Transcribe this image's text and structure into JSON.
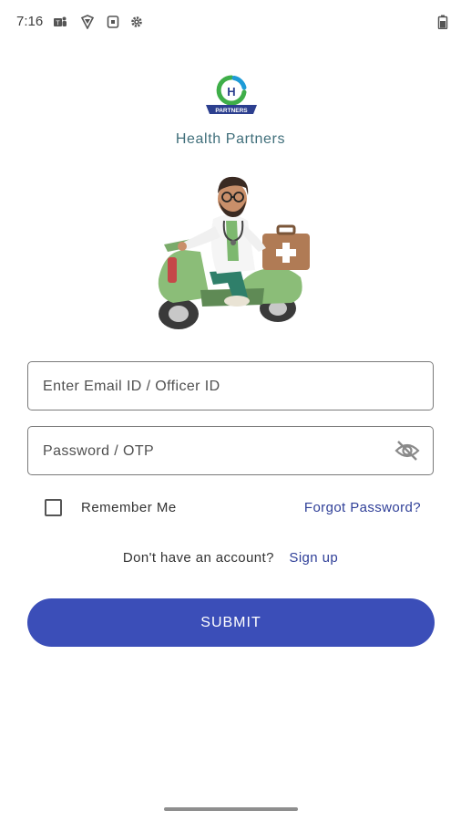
{
  "status_bar": {
    "time": "7:16"
  },
  "brand": {
    "title": "Health Partners",
    "logo_text": "PARTNERS",
    "logo_letter": "H"
  },
  "login_form": {
    "email_placeholder": "Enter Email ID / Officer ID",
    "password_placeholder": "Password / OTP",
    "remember_label": "Remember Me",
    "remember_checked": false,
    "forgot_label": "Forgot Password?",
    "signup_prompt": "Don't have an account?",
    "signup_label": "Sign up",
    "submit_label": "SUBMIT"
  },
  "icons": {
    "status": [
      "teams-icon",
      "vpn-shield-icon",
      "sim-card-icon",
      "gear-icon",
      "battery-icon"
    ],
    "password_toggle": "eye-off-icon"
  },
  "colors": {
    "primary": "#3b4eb8",
    "link": "#2f3f98",
    "brand_text": "#3f6e7a"
  }
}
